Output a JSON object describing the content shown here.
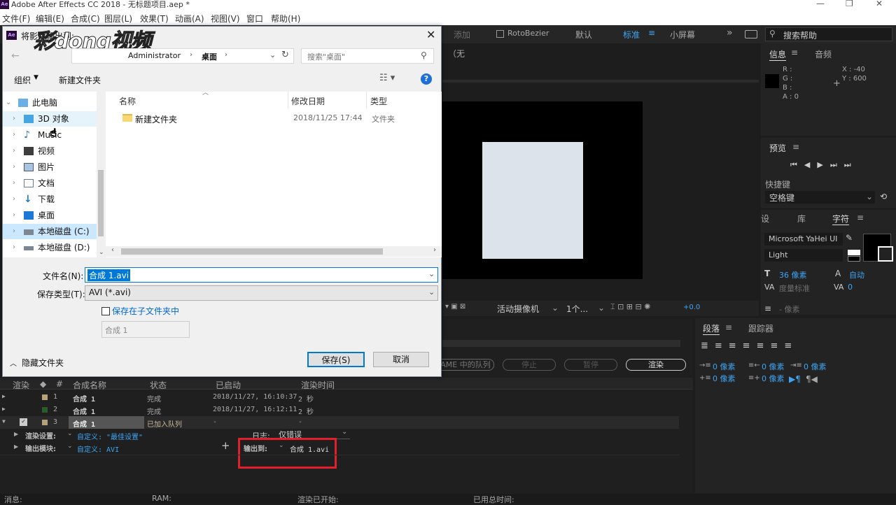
{
  "window": {
    "title": "Adobe After Effects CC 2018 - 无标题项目.aep *"
  },
  "menu": [
    "文件(F)",
    "编辑(E)",
    "合成(C)",
    "图层(L)",
    "效果(T)",
    "动画(A)",
    "视图(V)",
    "窗口",
    "帮助(H)"
  ],
  "toolbar": {
    "add": "添加",
    "rotobezier": "RotoBezier",
    "workspaces": [
      "默认",
      "标准",
      "小屏幕"
    ],
    "search_help": "搜索帮助"
  },
  "comp_panel": {
    "none_label": "（无",
    "bottom": {
      "camera": "活动摄像机",
      "view": "1个...",
      "exposure": "+0.0"
    }
  },
  "info": {
    "tab_info": "信息",
    "tab_audio": "音频",
    "r": "R :",
    "g": "G :",
    "b": "B :",
    "a": "A : 0",
    "x": "X : -40",
    "y": "Y : 600"
  },
  "preview": {
    "title": "预览",
    "shortcut_label": "快捷键",
    "shortcut_value": "空格键"
  },
  "character": {
    "tab_a": "设",
    "tab_b": "库",
    "tab_c": "字符",
    "font": "Microsoft YaHei UI",
    "style": "Light",
    "size": "36 像素",
    "leading": "自动",
    "tracking_label": "度量标准",
    "tracking_value": "0",
    "stroke": "- 像素"
  },
  "paragraph": {
    "tab": "段落",
    "tab2": "跟踪器",
    "vals": [
      "0 像素",
      "0 像素",
      "0 像素",
      "0 像素",
      "0 像素"
    ]
  },
  "render_queue": {
    "buttons": {
      "ame": "AME 中的队列",
      "stop": "停止",
      "pause": "暂停",
      "render": "渲染"
    },
    "headers": [
      "渲染",
      "#",
      "合成名称",
      "状态",
      "已启动",
      "渲染时间"
    ],
    "rows": [
      {
        "num": "1",
        "name": "合成 1",
        "status": "完成",
        "started": "2018/11/27, 16:10:37",
        "time": "2 秒"
      },
      {
        "num": "2",
        "name": "合成 1",
        "status": "完成",
        "started": "2018/11/27, 16:12:11",
        "time": "2 秒"
      },
      {
        "num": "3",
        "name": "合成 1",
        "status": "已加入队列",
        "started": "-",
        "time": "-"
      }
    ],
    "render_settings_label": "渲染设置:",
    "render_settings_value": "自定义: \"最佳设置\"",
    "log_label": "日志:",
    "log_value": "仅错误",
    "output_module_label": "输出模块:",
    "output_module_value": "自定义: AVI",
    "output_to_label": "输出到:",
    "output_to_value": "合成 1.avi"
  },
  "statusbar": {
    "msg": "消息:",
    "ram": "RAM:",
    "started": "渲染已开始:",
    "total": "已用总时间:"
  },
  "dialog": {
    "title": "将影片输出到:",
    "watermark": "彩dong视频",
    "path": [
      "Administrator",
      "桌面"
    ],
    "search_placeholder": "搜索\"桌面\"",
    "organize": "组织",
    "new_folder": "新建文件夹",
    "tree": [
      "此电脑",
      "3D 对象",
      "Music",
      "视频",
      "图片",
      "文档",
      "下载",
      "桌面",
      "本地磁盘 (C:)",
      "本地磁盘 (D:)"
    ],
    "columns": {
      "name": "名称",
      "date": "修改日期",
      "type": "类型"
    },
    "files": [
      {
        "name": "新建文件夹",
        "date": "2018/11/25 17:44",
        "type": "文件夹"
      }
    ],
    "filename_label": "文件名(N):",
    "filename_value": "合成 1.avi",
    "filetype_label": "保存类型(T):",
    "filetype_value": "AVI (*.avi)",
    "subfolder_label": "保存在子文件夹中",
    "subfolder_value": "合成 1",
    "hide_folders": "隐藏文件夹",
    "save": "保存(S)",
    "cancel": "取消"
  },
  "colors": {
    "accent": "#3ea5f4",
    "highlight_box": "#e0202a",
    "selection": "#0078d7"
  }
}
